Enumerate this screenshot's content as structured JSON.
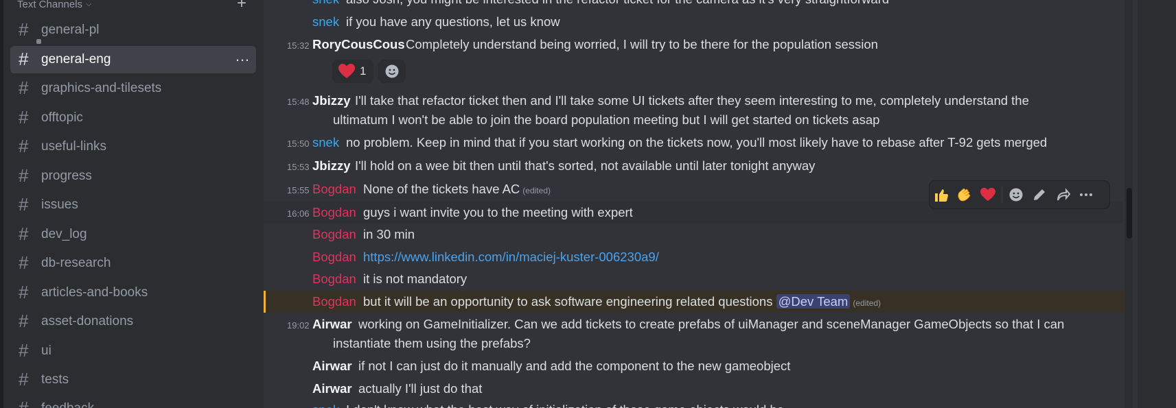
{
  "sidebar": {
    "category": "Text Channels",
    "channels": [
      {
        "name": "general-pl"
      },
      {
        "name": "general-eng"
      },
      {
        "name": "graphics-and-tilesets"
      },
      {
        "name": "offtopic"
      },
      {
        "name": "useful-links"
      },
      {
        "name": "progress"
      },
      {
        "name": "issues"
      },
      {
        "name": "dev_log"
      },
      {
        "name": "db-research"
      },
      {
        "name": "articles-and-books"
      },
      {
        "name": "asset-donations"
      },
      {
        "name": "ui"
      },
      {
        "name": "tests"
      },
      {
        "name": "feedback"
      }
    ],
    "active_channel": "general-eng",
    "more_label": "…"
  },
  "messages": [
    {
      "time": "",
      "author": "snek",
      "text": "also Josh, you might be interested in the refactor ticket for the camera as it's very straightforward"
    },
    {
      "time": "",
      "author": "snek",
      "text": "if you have any questions, let us know"
    },
    {
      "time": "15:32",
      "author": "RoryCousCous",
      "text": "Completely understand being worried, I will try to be there for the population session"
    },
    {
      "time": "15:48",
      "author": "Jbizzy",
      "text": "I'll take that refactor ticket then and I'll take some UI tickets after they seem interesting to me, completely understand the",
      "text2": "ultimatum I won't be able to join the board population meeting but I will get started on tickets asap"
    },
    {
      "time": "15:50",
      "author": "snek",
      "text": "no problem. Keep in mind that if you start working on the tickets now, you'll most likely have to rebase after T-92 gets merged"
    },
    {
      "time": "15:53",
      "author": "Jbizzy",
      "text": "I'll hold on a wee bit then until that's sorted, not available until later tonight anyway"
    },
    {
      "time": "15:55",
      "author": "Bogdan",
      "text": "None of the tickets have AC",
      "edited": "(edited)"
    },
    {
      "time": "16:06",
      "author": "Bogdan",
      "text": "guys i want invite you to the meeting with expert"
    },
    {
      "time": "",
      "author": "Bogdan",
      "text": "in 30 min"
    },
    {
      "time": "",
      "author": "Bogdan",
      "text": "https://www.linkedin.com/in/maciej-kuster-006230a9/"
    },
    {
      "time": "",
      "author": "Bogdan",
      "text": "it is not mandatory"
    },
    {
      "time": "",
      "author": "Bogdan",
      "text": "but it will be an opportunity to ask software engineering related questions",
      "mention": "@Dev Team",
      "edited": "(edited)"
    },
    {
      "time": "19:02",
      "author": "Airwar",
      "text": "working on GameInitializer. Can we add tickets to create prefabs of uiManager and sceneManager GameObjects so that I can",
      "text2": "instantiate them using the prefabs?"
    },
    {
      "time": "",
      "author": "Airwar",
      "text": "if not I can just do it manually and add the component to the new gameobject"
    },
    {
      "time": "",
      "author": "Airwar",
      "text": "actually I'll just do that"
    },
    {
      "time": "",
      "author": "snek",
      "text": "I don't know what the best way of initialization of those game objects would be"
    }
  ],
  "reactions": [
    {
      "emoji": "❤️",
      "count": "1"
    },
    {
      "emoji": "add-reaction"
    }
  ],
  "hover_toolbar": {
    "quick_reactions": [
      "👍",
      "👏",
      "❤️"
    ],
    "actions": [
      "add-reaction",
      "edit",
      "forward",
      "more"
    ]
  },
  "colors": {
    "sidebar_bg": "#2b2d31",
    "chat_bg": "#313338",
    "blue_user": "#3ea6e8",
    "red_user": "#e0335d",
    "link": "#4aa3ef",
    "highlight_border": "#f0b232"
  }
}
